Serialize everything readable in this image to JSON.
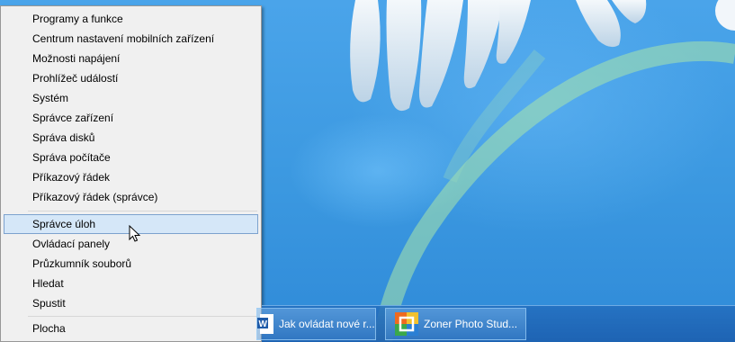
{
  "context_menu": {
    "items": [
      {
        "label": "Programy a funkce"
      },
      {
        "label": "Centrum nastavení mobilních zařízení"
      },
      {
        "label": "Možnosti napájení"
      },
      {
        "label": "Prohlížeč událostí"
      },
      {
        "label": "Systém"
      },
      {
        "label": "Správce zařízení"
      },
      {
        "label": "Správa disků"
      },
      {
        "label": "Správa počítače"
      },
      {
        "label": "Příkazový řádek"
      },
      {
        "label": "Příkazový řádek (správce)"
      },
      {
        "label": "Správce úloh",
        "selected": true
      },
      {
        "label": "Ovládací panely"
      },
      {
        "label": "Průzkumník souborů"
      },
      {
        "label": "Hledat"
      },
      {
        "label": "Spustit"
      },
      {
        "label": "Plocha"
      }
    ]
  },
  "taskbar": {
    "buttons": [
      {
        "label": "Jak ovládat nové r...",
        "icon": "word-document-icon"
      },
      {
        "label": "Zoner Photo Stud...",
        "icon": "zoner-photo-studio-icon"
      }
    ]
  },
  "colors": {
    "desktop": "#3d9be0",
    "menu_background": "#f0f0f0",
    "menu_selection": "#d5e7f8",
    "taskbar": "#236ebe"
  }
}
